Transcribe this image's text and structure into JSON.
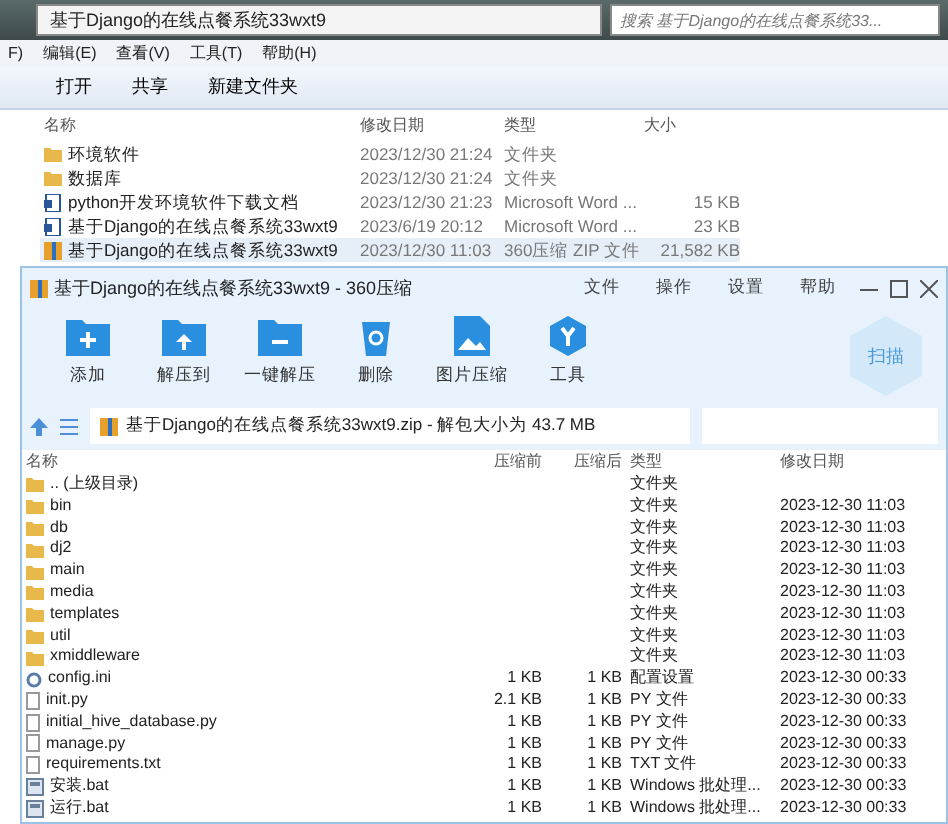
{
  "explorer": {
    "address": "基于Django的在线点餐系统33wxt9",
    "search": {
      "placeholder": "搜索 基于Django的在线点餐系统33..."
    },
    "menu": [
      "F)",
      "编辑(E)",
      "查看(V)",
      "工具(T)",
      "帮助(H)"
    ],
    "toolbar": [
      "打开",
      "共享",
      "新建文件夹"
    ],
    "columns": [
      "名称",
      "修改日期",
      "类型",
      "大小"
    ],
    "rows": [
      {
        "kind": "folder",
        "name": "环境软件",
        "date": "2023/12/30 21:24",
        "type": "文件夹",
        "size": "",
        "selected": false
      },
      {
        "kind": "folder",
        "name": "数据库",
        "date": "2023/12/30 21:24",
        "type": "文件夹",
        "size": "",
        "selected": false
      },
      {
        "kind": "word",
        "name": "python开发环境软件下载文档",
        "date": "2023/12/30 21:23",
        "type": "Microsoft Word ...",
        "size": "15 KB",
        "selected": false
      },
      {
        "kind": "word",
        "name": "基于Django的在线点餐系统33wxt9",
        "date": "2023/6/19 20:12",
        "type": "Microsoft Word ...",
        "size": "23 KB",
        "selected": false
      },
      {
        "kind": "zip",
        "name": "基于Django的在线点餐系统33wxt9",
        "date": "2023/12/30 11:03",
        "type": "360压缩 ZIP 文件",
        "size": "21,582 KB",
        "selected": true
      }
    ]
  },
  "zip": {
    "title": "基于Django的在线点餐系统33wxt9 - 360压缩",
    "menu": [
      "文件",
      "操作",
      "设置",
      "帮助"
    ],
    "tools": [
      {
        "kind": "add",
        "label": "添加"
      },
      {
        "kind": "extract",
        "label": "解压到"
      },
      {
        "kind": "oneclick",
        "label": "一键解压"
      },
      {
        "kind": "delete",
        "label": "删除"
      },
      {
        "kind": "image",
        "label": "图片压缩"
      },
      {
        "kind": "tools",
        "label": "工具"
      }
    ],
    "scan": "扫描",
    "path": "基于Django的在线点餐系统33wxt9.zip - 解包大小为 43.7 MB",
    "columns": [
      "名称",
      "压缩前",
      "压缩后",
      "类型",
      "修改日期"
    ],
    "rows": [
      {
        "kind": "folder",
        "name": ".. (上级目录)",
        "before": "",
        "after": "",
        "type": "文件夹",
        "date": ""
      },
      {
        "kind": "folder",
        "name": "bin",
        "before": "",
        "after": "",
        "type": "文件夹",
        "date": "2023-12-30 11:03"
      },
      {
        "kind": "folder",
        "name": "db",
        "before": "",
        "after": "",
        "type": "文件夹",
        "date": "2023-12-30 11:03"
      },
      {
        "kind": "folder",
        "name": "dj2",
        "before": "",
        "after": "",
        "type": "文件夹",
        "date": "2023-12-30 11:03"
      },
      {
        "kind": "folder",
        "name": "main",
        "before": "",
        "after": "",
        "type": "文件夹",
        "date": "2023-12-30 11:03"
      },
      {
        "kind": "folder",
        "name": "media",
        "before": "",
        "after": "",
        "type": "文件夹",
        "date": "2023-12-30 11:03"
      },
      {
        "kind": "folder",
        "name": "templates",
        "before": "",
        "after": "",
        "type": "文件夹",
        "date": "2023-12-30 11:03"
      },
      {
        "kind": "folder",
        "name": "util",
        "before": "",
        "after": "",
        "type": "文件夹",
        "date": "2023-12-30 11:03"
      },
      {
        "kind": "folder",
        "name": "xmiddleware",
        "before": "",
        "after": "",
        "type": "文件夹",
        "date": "2023-12-30 11:03"
      },
      {
        "kind": "config",
        "name": "config.ini",
        "before": "1 KB",
        "after": "1 KB",
        "type": "配置设置",
        "date": "2023-12-30 00:33"
      },
      {
        "kind": "file",
        "name": "init.py",
        "before": "2.1 KB",
        "after": "1 KB",
        "type": "PY 文件",
        "date": "2023-12-30 00:33"
      },
      {
        "kind": "file",
        "name": "initial_hive_database.py",
        "before": "1 KB",
        "after": "1 KB",
        "type": "PY 文件",
        "date": "2023-12-30 00:33"
      },
      {
        "kind": "file",
        "name": "manage.py",
        "before": "1 KB",
        "after": "1 KB",
        "type": "PY 文件",
        "date": "2023-12-30 00:33"
      },
      {
        "kind": "file",
        "name": "requirements.txt",
        "before": "1 KB",
        "after": "1 KB",
        "type": "TXT 文件",
        "date": "2023-12-30 00:33"
      },
      {
        "kind": "bat",
        "name": "安装.bat",
        "before": "1 KB",
        "after": "1 KB",
        "type": "Windows 批处理...",
        "date": "2023-12-30 00:33"
      },
      {
        "kind": "bat",
        "name": "运行.bat",
        "before": "1 KB",
        "after": "1 KB",
        "type": "Windows 批处理...",
        "date": "2023-12-30 00:33"
      }
    ]
  }
}
